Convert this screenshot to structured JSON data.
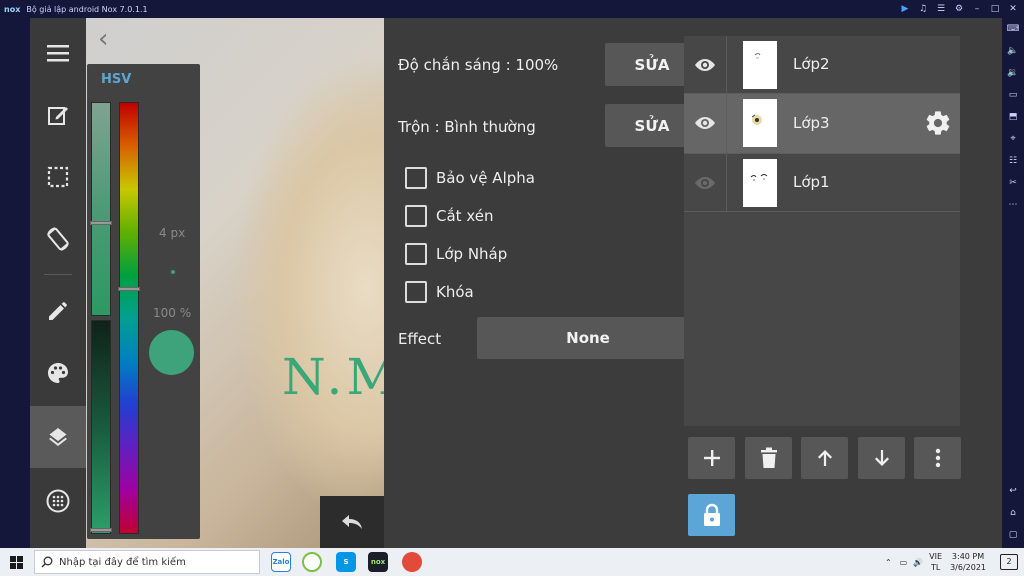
{
  "window": {
    "title": "Bộ giả lập android Nox 7.0.1.1",
    "logo": "nox"
  },
  "color_panel": {
    "mode_label": "HSV",
    "brush_size": "4 px",
    "opacity": "100 %",
    "current_color": "#3ea27b"
  },
  "properties": {
    "opacity_label": "Độ chắn sáng : 100%",
    "opacity_edit": "SỬA",
    "blend_label": "Trộn : Bình thường",
    "blend_edit": "SỬA",
    "checkboxes": [
      {
        "label": "Bảo vệ Alpha",
        "checked": false
      },
      {
        "label": "Cắt xén",
        "checked": false
      },
      {
        "label": "Lớp Nháp",
        "checked": false
      },
      {
        "label": "Khóa",
        "checked": false
      }
    ],
    "effect_label": "Effect",
    "effect_value": "None"
  },
  "layers": [
    {
      "name": "Lớp2",
      "visible": true,
      "selected": false
    },
    {
      "name": "Lớp3",
      "visible": true,
      "selected": true
    },
    {
      "name": "Lớp1",
      "visible": false,
      "selected": false
    }
  ],
  "taskbar": {
    "search_placeholder": "Nhập tại đây để tìm kiếm",
    "time": "3:40 PM",
    "date": "3/6/2021",
    "lang_top": "VIE",
    "lang_bottom": "TL",
    "notification_count": "2",
    "zalo_label": "Zalo",
    "nox_label": "nox"
  },
  "colors": {
    "accent": "#5ba6d6",
    "panel": "#3c3c3c",
    "button": "#575757",
    "selected_row": "#666666"
  }
}
